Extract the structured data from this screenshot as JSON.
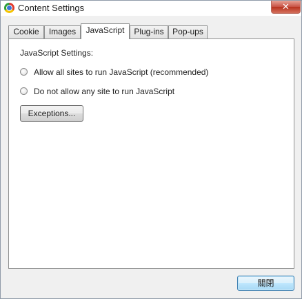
{
  "window": {
    "title": "Content Settings",
    "close_glyph": "✕"
  },
  "tabs": [
    {
      "label": "Cookie",
      "active": false
    },
    {
      "label": "Images",
      "active": false
    },
    {
      "label": "JavaScript",
      "active": true
    },
    {
      "label": "Plug-ins",
      "active": false
    },
    {
      "label": "Pop-ups",
      "active": false
    }
  ],
  "javascript": {
    "group_label": "JavaScript Settings:",
    "options": [
      {
        "label": "Allow all sites to run JavaScript (recommended)",
        "checked": false
      },
      {
        "label": "Do not allow any site to run JavaScript",
        "checked": false
      }
    ],
    "exceptions_button": "Exceptions..."
  },
  "footer": {
    "close_button": "關閉"
  },
  "icons": {
    "app": "chrome-icon",
    "radio": "radio-icon"
  }
}
